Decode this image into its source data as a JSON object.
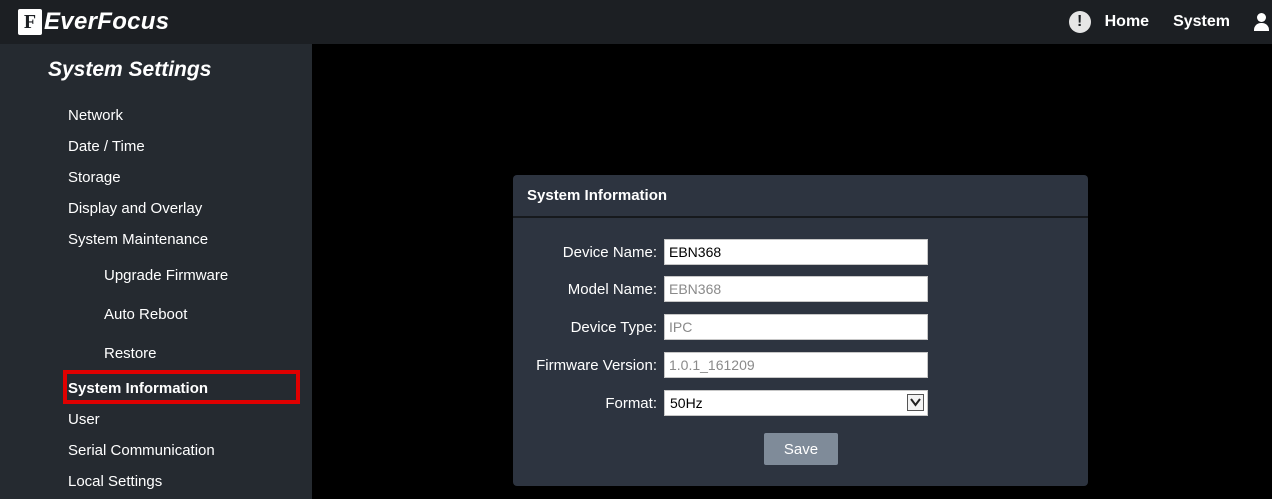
{
  "header": {
    "logo_mark": "F",
    "logo_text": "EverFocus",
    "nav": {
      "home": "Home",
      "system": "System"
    },
    "alert_symbol": "!"
  },
  "sidebar": {
    "title": "System Settings",
    "items": [
      {
        "label": "Network"
      },
      {
        "label": "Date / Time"
      },
      {
        "label": "Storage"
      },
      {
        "label": "Display and Overlay"
      },
      {
        "label": "System Maintenance"
      },
      {
        "label": "Upgrade Firmware"
      },
      {
        "label": "Auto Reboot"
      },
      {
        "label": "Restore"
      },
      {
        "label": "System Information"
      },
      {
        "label": "User"
      },
      {
        "label": "Serial Communication"
      },
      {
        "label": "Local Settings"
      }
    ]
  },
  "panel": {
    "title": "System Information",
    "fields": {
      "device_name": {
        "label": "Device Name:",
        "value": "EBN368"
      },
      "model_name": {
        "label": "Model Name:",
        "value": "EBN368"
      },
      "device_type": {
        "label": "Device Type:",
        "value": "IPC"
      },
      "firmware_version": {
        "label": "Firmware Version:",
        "value": "1.0.1_161209"
      },
      "format": {
        "label": "Format:",
        "value": "50Hz"
      }
    },
    "save_label": "Save"
  },
  "colors": {
    "topbar": "#1c1f23",
    "sidebar": "#252a30",
    "panel": "#2d3440",
    "highlight": "#e00000",
    "save_button": "#7f8b99"
  },
  "icons": [
    "alert-icon",
    "user-icon",
    "chevron-down-icon"
  ]
}
